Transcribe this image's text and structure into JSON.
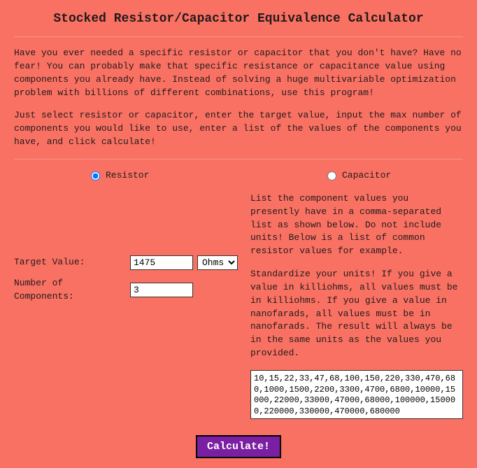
{
  "title": "Stocked Resistor/Capacitor Equivalence Calculator",
  "intro1": "Have you ever needed a specific resistor or capacitor that you don't have? Have no fear! You can probably make that specific resistance or capacitance value using components you already have. Instead of solving a huge multivariable optimization problem with billions of different combinations, use this program!",
  "intro2": "Just select resistor or capacitor, enter the target value, input the max number of components you would like to use, enter a list of the values of the components you have, and click calculate!",
  "radio": {
    "resistor_label": "Resistor",
    "capacitor_label": "Capacitor",
    "selected": "resistor"
  },
  "form": {
    "target_label": "Target Value:",
    "target_value": "1475",
    "unit_selected": "Ohms",
    "num_label": "Number of Components:",
    "num_value": "3"
  },
  "right": {
    "para1": "List the component values you presently have in a comma-separated list as shown below. Do not include units! Below is a list of common resistor values for example.",
    "para2": "Standardize your units! If you give a value in killiohms, all values must be in killiohms. If you give a value in nanofarads, all values must be in nanofarads. The result will always be in the same units as the values you provided.",
    "values_list": "10,15,22,33,47,68,100,150,220,330,470,680,1000,1500,2200,3300,4700,6800,10000,15000,22000,33000,47000,68000,100000,150000,220000,330000,470000,680000"
  },
  "calculate_label": "Calculate!"
}
